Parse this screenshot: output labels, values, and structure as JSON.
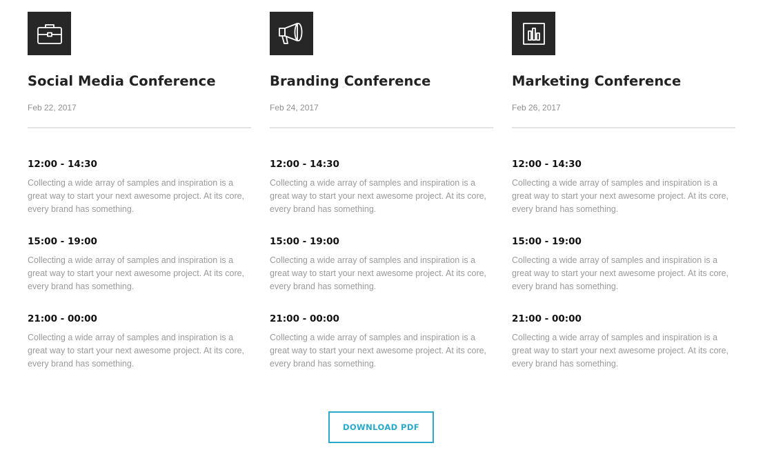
{
  "conferences": [
    {
      "icon": "briefcase-icon",
      "title": "Social Media Conference",
      "date": "Feb 22, 2017",
      "sessions": [
        {
          "time": "12:00 - 14:30",
          "description": "Collecting a wide array of samples and inspiration is a great way to start your next awesome project. At its core, every brand has something."
        },
        {
          "time": "15:00 - 19:00",
          "description": "Collecting a wide array of samples and inspiration is a great way to start your next awesome project. At its core, every brand has something."
        },
        {
          "time": "21:00 - 00:00",
          "description": "Collecting a wide array of samples and inspiration is a great way to start your next awesome project. At its core, every brand has something."
        }
      ]
    },
    {
      "icon": "megaphone-icon",
      "title": "Branding Conference",
      "date": "Feb 24, 2017",
      "sessions": [
        {
          "time": "12:00 - 14:30",
          "description": "Collecting a wide array of samples and inspiration is a great way to start your next awesome project. At its core, every brand has something."
        },
        {
          "time": "15:00 - 19:00",
          "description": "Collecting a wide array of samples and inspiration is a great way to start your next awesome project. At its core, every brand has something."
        },
        {
          "time": "21:00 - 00:00",
          "description": "Collecting a wide array of samples and inspiration is a great way to start your next awesome project. At its core, every brand has something."
        }
      ]
    },
    {
      "icon": "bar-chart-icon",
      "title": "Marketing Conference",
      "date": "Feb 26, 2017",
      "sessions": [
        {
          "time": "12:00 - 14:30",
          "description": "Collecting a wide array of samples and inspiration is a great way to start your next awesome project. At its core, every brand has something."
        },
        {
          "time": "15:00 - 19:00",
          "description": "Collecting a wide array of samples and inspiration is a great way to start your next awesome project. At its core, every brand has something."
        },
        {
          "time": "21:00 - 00:00",
          "description": "Collecting a wide array of samples and inspiration is a great way to start your next awesome project. At its core, every brand has something."
        }
      ]
    }
  ],
  "download_button": {
    "label": "DOWNLOAD PDF"
  },
  "colors": {
    "icon_background": "#272727",
    "accent": "#29a9c9",
    "title_text": "#222222",
    "muted_text": "#9a9a9a",
    "divider": "#e3e3e3"
  }
}
